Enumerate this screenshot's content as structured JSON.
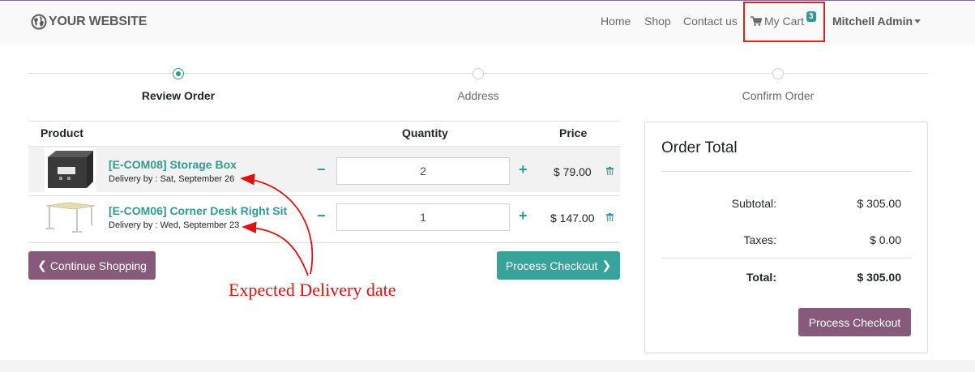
{
  "navbar": {
    "brand": "YOUR WEBSITE",
    "links": [
      "Home",
      "Shop",
      "Contact us"
    ],
    "cart_label": "My Cart",
    "cart_count": "3",
    "user": "Mitchell Admin"
  },
  "steps": [
    {
      "label": "Review Order",
      "active": true
    },
    {
      "label": "Address",
      "active": false
    },
    {
      "label": "Confirm Order",
      "active": false
    }
  ],
  "table": {
    "headers": {
      "product": "Product",
      "quantity": "Quantity",
      "price": "Price"
    },
    "rows": [
      {
        "name": "[E-COM08] Storage Box",
        "delivery": "Delivery by : Sat, September 26",
        "quantity": "2",
        "price": "$ 79.00"
      },
      {
        "name": "[E-COM06] Corner Desk Right Sit",
        "delivery": "Delivery by : Wed, September 23",
        "quantity": "1",
        "price": "$ 147.00"
      }
    ]
  },
  "buttons": {
    "continue_shopping": "Continue Shopping",
    "process_checkout": "Process Checkout"
  },
  "annotation": "Expected Delivery date",
  "order_total": {
    "title": "Order Total",
    "subtotal_label": "Subtotal:",
    "subtotal": "$ 305.00",
    "taxes_label": "Taxes:",
    "taxes": "$ 0.00",
    "total_label": "Total:",
    "total": "$ 305.00",
    "button": "Process Checkout"
  },
  "colors": {
    "accent": "#2e9c94",
    "primary": "#875a7b",
    "annotation": "#e01010"
  }
}
